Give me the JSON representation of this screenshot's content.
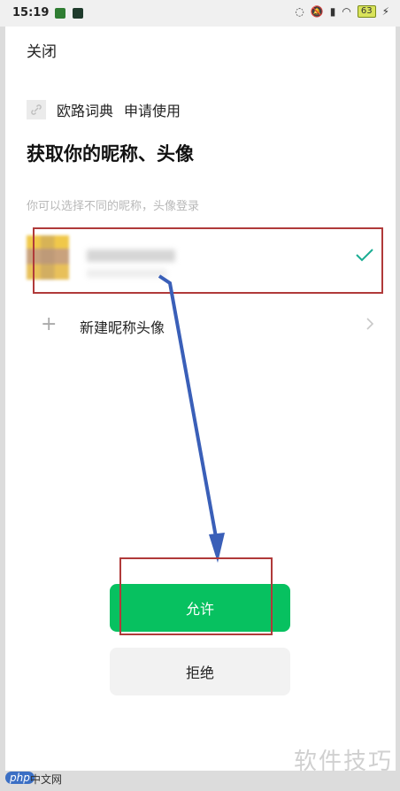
{
  "status_bar": {
    "time": "15:19",
    "battery": "63"
  },
  "header": {
    "close_label": "关闭"
  },
  "app": {
    "name": "欧路词典",
    "action": "申请使用"
  },
  "title": "获取你的昵称、头像",
  "hint": "你可以选择不同的昵称，头像登录",
  "new_profile_label": "新建昵称头像",
  "buttons": {
    "allow": "允许",
    "reject": "拒绝"
  },
  "watermarks": {
    "php": "php",
    "cn": "中文网",
    "right": "软件技巧"
  },
  "colors": {
    "primary": "#07c160",
    "check": "#1aad93",
    "annotation": "#b03a3a",
    "arrow": "#3a5fb8"
  }
}
